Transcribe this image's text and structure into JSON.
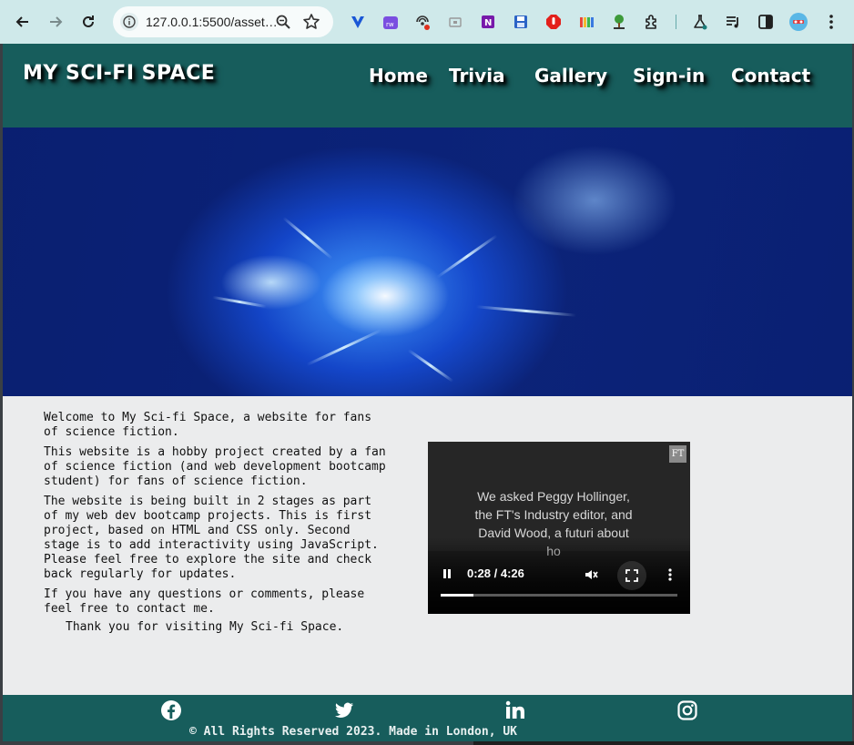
{
  "browser": {
    "url": "127.0.0.1:5500/asset…"
  },
  "site": {
    "brand": "MY SCI-FI SPACE",
    "nav": [
      {
        "label": "Home"
      },
      {
        "label": "Trivia"
      },
      {
        "label": "Gallery"
      },
      {
        "label": "Sign-in"
      },
      {
        "label": "Contact"
      }
    ]
  },
  "main": {
    "paragraphs": [
      "Welcome to My Sci-fi Space, a website for fans of science fiction.",
      "This website is a hobby project created by a fan of science fiction (and web development bootcamp student) for fans of science fiction.",
      "The website is being built in 2 stages as part of my web dev bootcamp projects. This is first project, based on HTML and CSS only. Second stage is to add interactivity using JavaScript. Please feel free to explore the site and check back regularly for updates.",
      "If you have any questions or comments, please feel free to contact me."
    ],
    "thanks": "Thank you for visiting My Sci-fi Space."
  },
  "video": {
    "logo": "FT",
    "caption": "We asked Peggy Hollinger, the FT's Industry editor, and David Wood, a futuri about ho",
    "time": "0:28 / 4:26",
    "progress": 0.14
  },
  "footer": {
    "icons": [
      "facebook-icon",
      "twitter-icon",
      "linkedin-icon",
      "instagram-icon"
    ],
    "copyright": "© All Rights Reserved 2023. Made in London, UK"
  },
  "colors": {
    "header_bg": "#175d5c",
    "page_bg": "#ebeced",
    "chrome_bg": "#cfe9ea"
  }
}
